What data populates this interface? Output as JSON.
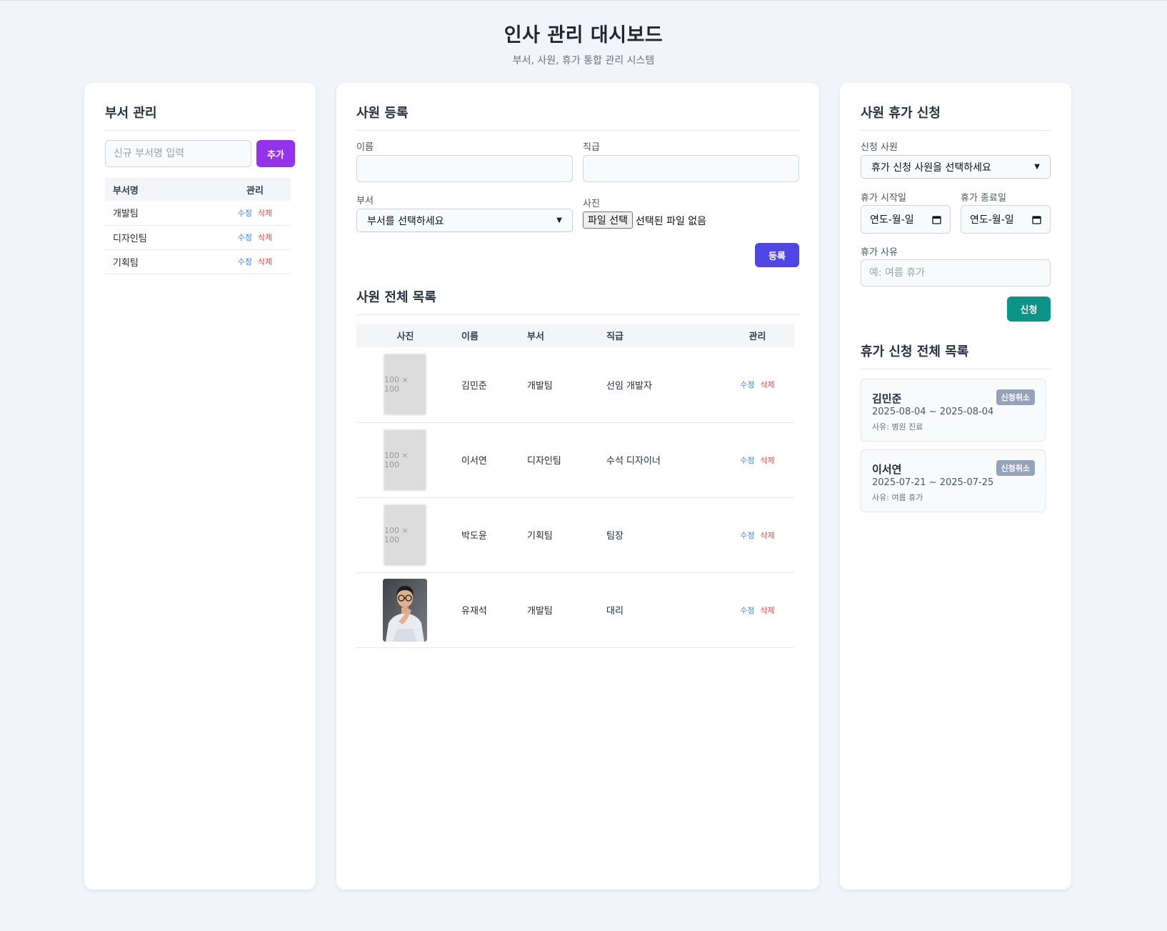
{
  "header": {
    "title": "인사 관리 대시보드",
    "subtitle": "부서, 사원, 휴가 통합 관리 시스템"
  },
  "departments": {
    "title": "부서 관리",
    "input_placeholder": "신규 부서명 입력",
    "add_label": "추가",
    "columns": [
      "부서명",
      "관리"
    ],
    "rows": [
      {
        "name": "개발팀",
        "edit": "수정",
        "delete": "삭제"
      },
      {
        "name": "디자인팀",
        "edit": "수정",
        "delete": "삭제"
      },
      {
        "name": "기획팀",
        "edit": "수정",
        "delete": "삭제"
      }
    ]
  },
  "employee_form": {
    "title": "사원 등록",
    "name_label": "이름",
    "position_label": "직급",
    "dept_label": "부서",
    "dept_select": "부서를 선택하세요",
    "photo_label": "사진",
    "file_button": "파일 선택",
    "file_status": "선택된 파일 없음",
    "submit_label": "등록"
  },
  "employee_list": {
    "title": "사원 전체 목록",
    "columns": [
      "사진",
      "이름",
      "부서",
      "직급",
      "관리"
    ],
    "rows": [
      {
        "photo": "100 × 100",
        "name": "김민준",
        "dept": "개발팀",
        "position": "선임 개발자",
        "edit": "수정",
        "delete": "삭제"
      },
      {
        "photo": "100 × 100",
        "name": "이서연",
        "dept": "디자인팀",
        "position": "수석 디자이너",
        "edit": "수정",
        "delete": "삭제"
      },
      {
        "photo": "100 × 100",
        "name": "박도윤",
        "dept": "기획팀",
        "position": "팀장",
        "edit": "수정",
        "delete": "삭제"
      },
      {
        "photo": "",
        "name": "유재석",
        "dept": "개발팀",
        "position": "대리",
        "edit": "수정",
        "delete": "삭제"
      }
    ]
  },
  "leave_form": {
    "title": "사원 휴가 신청",
    "employee_label": "신청 사원",
    "employee_select": "휴가 신청 사원을 선택하세요",
    "start_label": "휴가 시작일",
    "end_label": "휴가 종료일",
    "date_placeholder": "연도-월-일",
    "reason_label": "휴가 사유",
    "reason_placeholder": "예: 여름 휴가",
    "submit_label": "신청"
  },
  "leave_list": {
    "title": "휴가 신청 전체 목록",
    "items": [
      {
        "name": "김민준",
        "dates": "2025-08-04 ~ 2025-08-04",
        "reason": "사유: 병원 진료",
        "badge": "신청취소"
      },
      {
        "name": "이서연",
        "dates": "2025-07-21 ~ 2025-07-25",
        "reason": "사유: 여름 휴가",
        "badge": "신청취소"
      }
    ]
  },
  "colors": {
    "add_button": "#9333ea",
    "register_button": "#4f46e5",
    "apply_button": "#0d9488",
    "badge": "#94a3b8",
    "edit_link": "#3b82f6",
    "delete_link": "#ef4444"
  }
}
